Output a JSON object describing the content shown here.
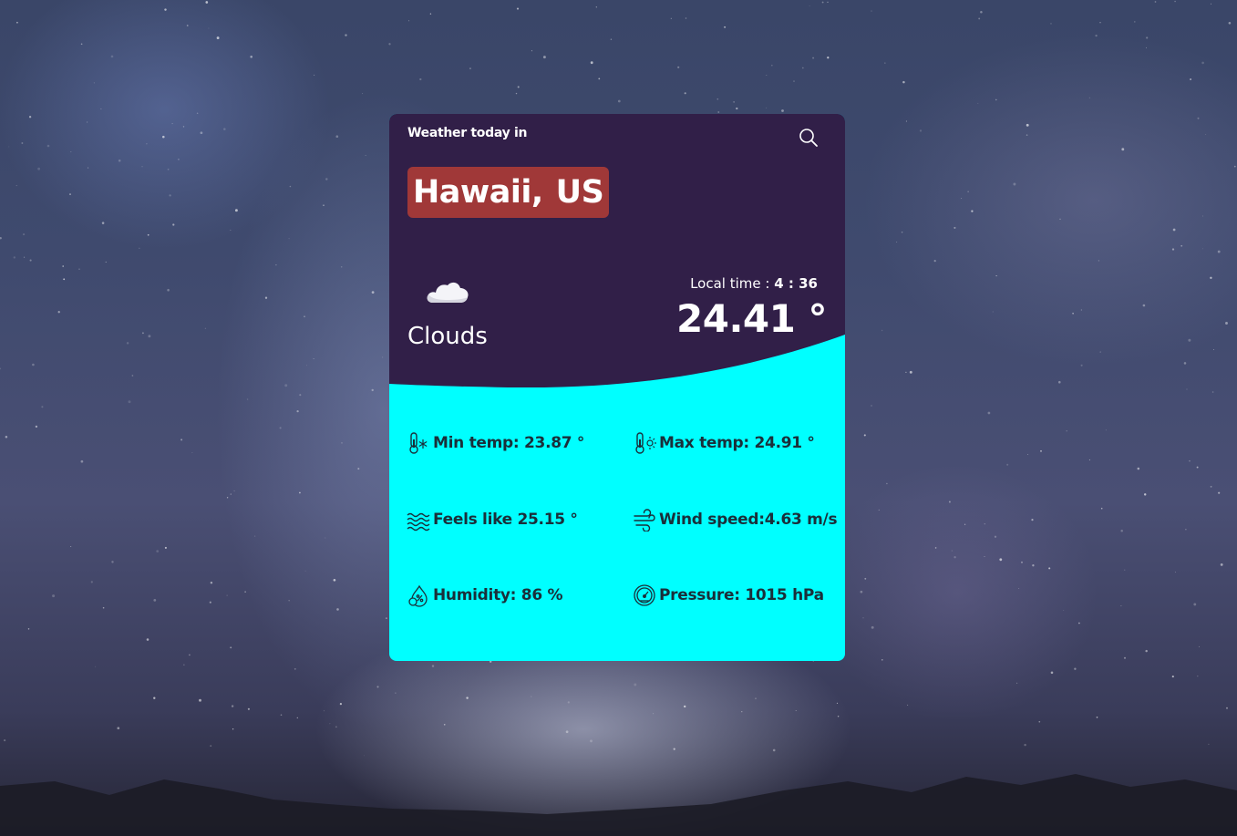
{
  "header": {
    "heading": "Weather today in",
    "city": "Hawaii,",
    "country": "US"
  },
  "current": {
    "condition": "Clouds",
    "condition_icon": "cloud-icon",
    "local_time_label": "Local time :",
    "local_time": "4 : 36",
    "temperature": "24.41 °"
  },
  "stats": {
    "min_temp": "Min temp: 23.87 °",
    "max_temp": "Max temp: 24.91 °",
    "feels_like": "Feels like 25.15 °",
    "wind_speed": "Wind speed:4.63 m/s",
    "humidity": "Humidity: 86 %",
    "pressure": "Pressure: 1015 hPa"
  },
  "icons": {
    "search": "search-icon",
    "min_temp": "thermometer-cold-icon",
    "max_temp": "thermometer-hot-icon",
    "feels_like": "waves-icon",
    "wind": "wind-icon",
    "humidity": "humidity-icon",
    "pressure": "gauge-icon"
  },
  "colors": {
    "card_top": "#311f48",
    "card_bottom": "#00ffff",
    "city_badge": "#a03838"
  }
}
